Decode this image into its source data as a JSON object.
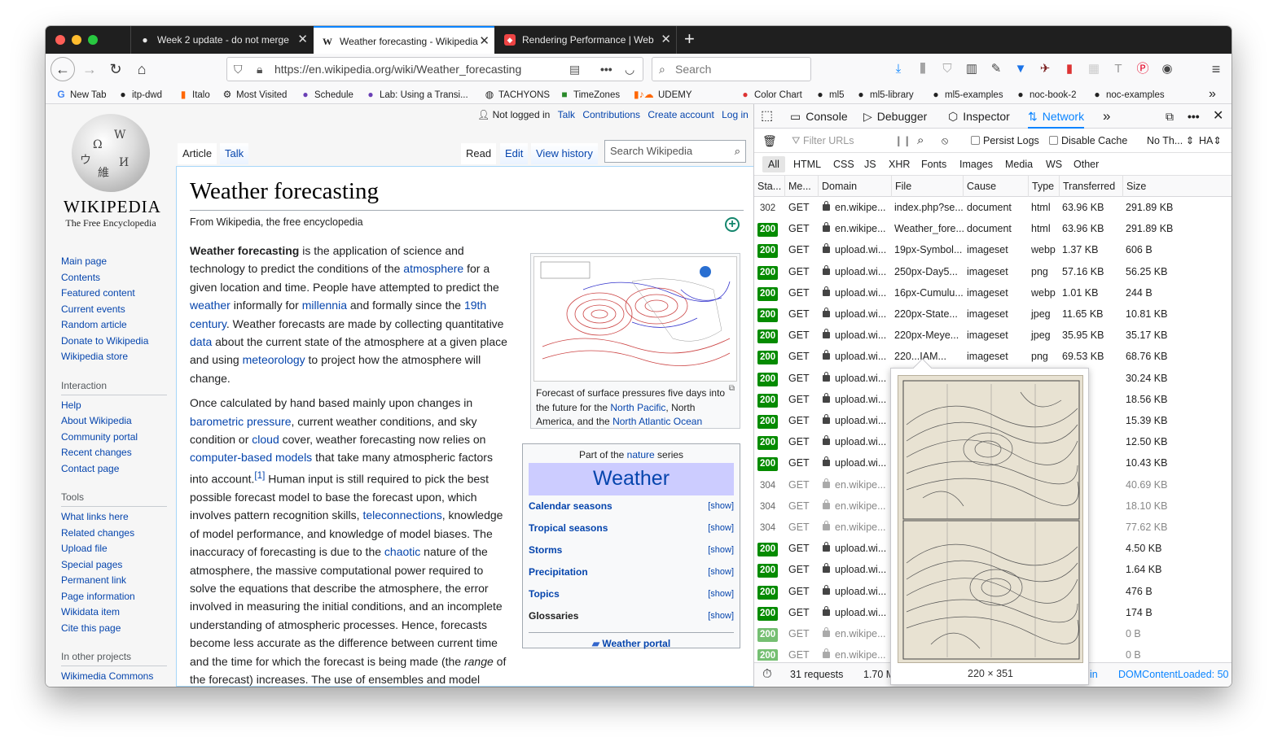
{
  "browser": {
    "tabs": [
      {
        "title": "Week 2 update - do not merge",
        "icon": "github-icon"
      },
      {
        "title": "Weather forecasting - Wikipedia",
        "icon": "wikipedia-icon"
      },
      {
        "title": "Rendering Performance | Web",
        "icon": "web-icon"
      }
    ],
    "url": "https://en.wikipedia.org/wiki/Weather_forecasting",
    "search_placeholder": "Search",
    "bookmarks": [
      "New Tab",
      "itp-dwd",
      "Italo",
      "Most Visited",
      "Schedule",
      "Lab: Using a Transi...",
      "TACHYONS",
      "TimeZones",
      "UDEMY",
      "Color Chart",
      "ml5",
      "ml5-library",
      "ml5-examples",
      "noc-book-2",
      "noc-examples"
    ]
  },
  "wiki": {
    "wordmark": "Wikipedia",
    "tagline": "The Free Encyclopedia",
    "user_tools": {
      "not_logged": "Not logged in",
      "talk": "Talk",
      "contributions": "Contributions",
      "create": "Create account",
      "login": "Log in"
    },
    "tabs": {
      "article": "Article",
      "talk": "Talk",
      "read": "Read",
      "edit": "Edit",
      "history": "View history"
    },
    "search_placeholder": "Search Wikipedia",
    "nav_main": [
      "Main page",
      "Contents",
      "Featured content",
      "Current events",
      "Random article",
      "Donate to Wikipedia",
      "Wikipedia store"
    ],
    "interaction_heading": "Interaction",
    "nav_interaction": [
      "Help",
      "About Wikipedia",
      "Community portal",
      "Recent changes",
      "Contact page"
    ],
    "tools_heading": "Tools",
    "nav_tools": [
      "What links here",
      "Related changes",
      "Upload file",
      "Special pages",
      "Permanent link",
      "Page information",
      "Wikidata item",
      "Cite this page"
    ],
    "projects_heading": "In other projects",
    "nav_projects": [
      "Wikimedia Commons"
    ],
    "title": "Weather forecasting",
    "subtitle": "From Wikipedia, the free encyclopedia",
    "thumb_caption": {
      "pre": "Forecast of surface pressures five days into the future for the ",
      "link1": "North Pacific",
      "mid": ", North America, and the ",
      "link2": "North Atlantic Ocean"
    },
    "navbox": {
      "part_of_pre": "Part of the ",
      "part_of_link": "nature",
      "part_of_post": " series",
      "heading": "Weather",
      "rows": [
        "Calendar seasons",
        "Tropical seasons",
        "Storms",
        "Precipitation",
        "Topics",
        "Glossaries"
      ],
      "show": "[show]",
      "portal": "Weather portal"
    }
  },
  "devtools": {
    "tabs": [
      "Console",
      "Debugger",
      "Inspector",
      "Network"
    ],
    "active_tab": "Network",
    "filter_placeholder": "Filter URLs",
    "persist_logs": "Persist Logs",
    "disable_cache": "Disable Cache",
    "throttle": "No Th...",
    "har": "HA",
    "types": [
      "All",
      "HTML",
      "CSS",
      "JS",
      "XHR",
      "Fonts",
      "Images",
      "Media",
      "WS",
      "Other"
    ],
    "columns": [
      "Sta...",
      "Me...",
      "Domain",
      "File",
      "Cause",
      "Type",
      "Transferred",
      "Size"
    ],
    "rows": [
      {
        "status": "302",
        "method": "GET",
        "domain": "en.wikipe...",
        "file": "index.php?se...",
        "cause": "document",
        "type": "html",
        "transferred": "63.96 KB",
        "size": "291.89 KB",
        "style": "r"
      },
      {
        "status": "200",
        "method": "GET",
        "domain": "en.wikipe...",
        "file": "Weather_fore...",
        "cause": "document",
        "type": "html",
        "transferred": "63.96 KB",
        "size": "291.89 KB",
        "style": "ok"
      },
      {
        "status": "200",
        "method": "GET",
        "domain": "upload.wi...",
        "file": "19px-Symbol...",
        "cause": "imageset",
        "type": "webp",
        "transferred": "1.37 KB",
        "size": "606 B",
        "style": "ok"
      },
      {
        "status": "200",
        "method": "GET",
        "domain": "upload.wi...",
        "file": "250px-Day5...",
        "cause": "imageset",
        "type": "png",
        "transferred": "57.16 KB",
        "size": "56.25 KB",
        "style": "ok"
      },
      {
        "status": "200",
        "method": "GET",
        "domain": "upload.wi...",
        "file": "16px-Cumulu...",
        "cause": "imageset",
        "type": "webp",
        "transferred": "1.01 KB",
        "size": "244 B",
        "style": "ok"
      },
      {
        "status": "200",
        "method": "GET",
        "domain": "upload.wi...",
        "file": "220px-State...",
        "cause": "imageset",
        "type": "jpeg",
        "transferred": "11.65 KB",
        "size": "10.81 KB",
        "style": "ok"
      },
      {
        "status": "200",
        "method": "GET",
        "domain": "upload.wi...",
        "file": "220px-Meye...",
        "cause": "imageset",
        "type": "jpeg",
        "transferred": "35.95 KB",
        "size": "35.17 KB",
        "style": "ok"
      },
      {
        "status": "200",
        "method": "GET",
        "domain": "upload.wi...",
        "file": "220...IAM...",
        "cause": "imageset",
        "type": "png",
        "transferred": "69.53 KB",
        "size": "68.76 KB",
        "style": "ok"
      },
      {
        "status": "200",
        "method": "GET",
        "domain": "upload.wi...",
        "file": "",
        "cause": "",
        "type": "",
        "transferred": "KB",
        "size": "30.24 KB",
        "style": "ok"
      },
      {
        "status": "200",
        "method": "GET",
        "domain": "upload.wi...",
        "file": "",
        "cause": "",
        "type": "",
        "transferred": "KB",
        "size": "18.56 KB",
        "style": "ok"
      },
      {
        "status": "200",
        "method": "GET",
        "domain": "upload.wi...",
        "file": "",
        "cause": "",
        "type": "",
        "transferred": "KB",
        "size": "15.39 KB",
        "style": "ok"
      },
      {
        "status": "200",
        "method": "GET",
        "domain": "upload.wi...",
        "file": "",
        "cause": "",
        "type": "",
        "transferred": "KB",
        "size": "12.50 KB",
        "style": "ok"
      },
      {
        "status": "200",
        "method": "GET",
        "domain": "upload.wi...",
        "file": "",
        "cause": "",
        "type": "",
        "transferred": "KB",
        "size": "10.43 KB",
        "style": "ok"
      },
      {
        "status": "304",
        "method": "GET",
        "domain": "en.wikipe...",
        "file": "",
        "cause": "",
        "type": "",
        "transferred": "d",
        "size": "40.69 KB",
        "style": "g"
      },
      {
        "status": "304",
        "method": "GET",
        "domain": "en.wikipe...",
        "file": "",
        "cause": "",
        "type": "",
        "transferred": "d",
        "size": "18.10 KB",
        "style": "g"
      },
      {
        "status": "304",
        "method": "GET",
        "domain": "en.wikipe...",
        "file": "",
        "cause": "",
        "type": "",
        "transferred": "d",
        "size": "77.62 KB",
        "style": "g"
      },
      {
        "status": "200",
        "method": "GET",
        "domain": "upload.wi...",
        "file": "",
        "cause": "",
        "type": "",
        "transferred": "KB",
        "size": "4.50 KB",
        "style": "ok"
      },
      {
        "status": "200",
        "method": "GET",
        "domain": "upload.wi...",
        "file": "",
        "cause": "",
        "type": "",
        "transferred": "KB",
        "size": "1.64 KB",
        "style": "ok"
      },
      {
        "status": "200",
        "method": "GET",
        "domain": "upload.wi...",
        "file": "",
        "cause": "",
        "type": "",
        "transferred": "B",
        "size": "476 B",
        "style": "ok"
      },
      {
        "status": "200",
        "method": "GET",
        "domain": "upload.wi...",
        "file": "",
        "cause": "",
        "type": "",
        "transferred": "",
        "size": "174 B",
        "style": "ok"
      },
      {
        "status": "200",
        "method": "GET",
        "domain": "en.wikipe...",
        "file": "",
        "cause": "",
        "type": "",
        "transferred": "d",
        "size": "0 B",
        "style": "fade"
      },
      {
        "status": "200",
        "method": "GET",
        "domain": "en.wikipe...",
        "file": "",
        "cause": "",
        "type": "",
        "transferred": "d",
        "size": "0 B",
        "style": "fade"
      }
    ],
    "footer": {
      "requests": "31 requests",
      "transferred": "1.70 M",
      "load": "in",
      "dcl": "DOMContentLoaded: 50"
    },
    "preview_size": "220 × 351"
  }
}
